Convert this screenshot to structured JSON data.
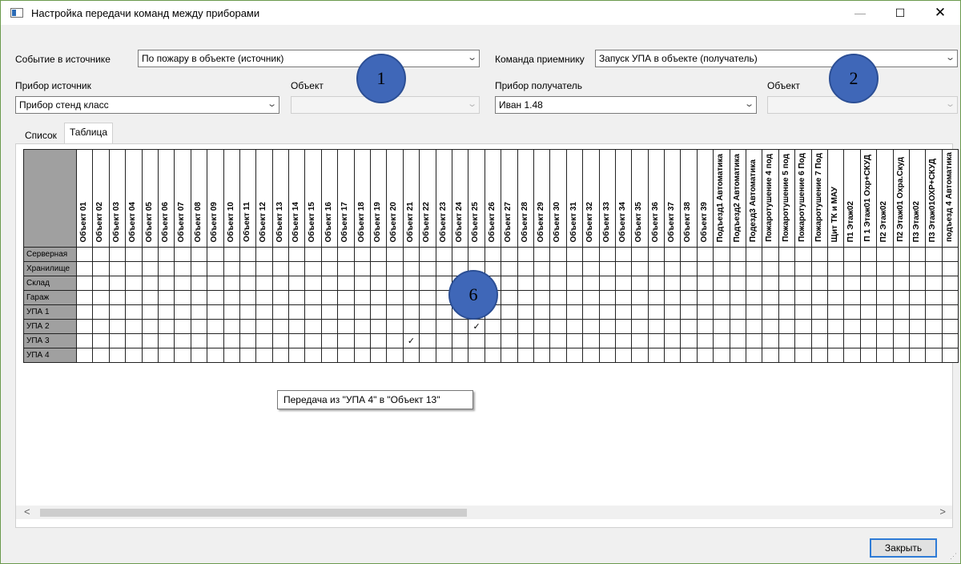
{
  "window": {
    "title": "Настройка передачи команд между приборами",
    "minimize": "—",
    "maximize": "☐",
    "close": "✕"
  },
  "source": {
    "event_label": "Событие в источнике",
    "event_value": "По пожару в объекте (источник)",
    "device_label": "Прибор источник",
    "device_value": "Прибор стенд класс",
    "object_label": "Объект",
    "object_value": ""
  },
  "target": {
    "command_label": "Команда приемнику",
    "command_value": "Запуск УПА в объекте (получатель)",
    "device_label": "Прибор получатель",
    "device_value": "Иван 1.48",
    "object_label": "Объект",
    "object_value": ""
  },
  "badges": {
    "b1": "1",
    "b2": "2",
    "b6": "6"
  },
  "tabs": {
    "list": "Список",
    "table": "Таблица"
  },
  "grid": {
    "columns": [
      "Объект 01",
      "Объект 02",
      "Объект 03",
      "Объект 04",
      "Объект 05",
      "Объект 06",
      "Объект 07",
      "Объект 08",
      "Объект 09",
      "Объект 10",
      "Объект 11",
      "Объект 12",
      "Объект 13",
      "Объект 14",
      "Объект 15",
      "Объект 16",
      "Объект 17",
      "Объект 18",
      "Объект 19",
      "Объект 20",
      "Объект 21",
      "Объект 22",
      "Объект 23",
      "Объект 24",
      "Объект 25",
      "Объект 26",
      "Объект 27",
      "Объект 28",
      "Объект 29",
      "Объект 30",
      "Объект 31",
      "Объект 32",
      "Объект 33",
      "Объект 34",
      "Объект 35",
      "Объект 36",
      "Объект 37",
      "Объект 38",
      "Объект 39",
      "Подъезд1 Автоматика",
      "Подъезд2 Автоматика",
      "Подезд3 Автоматика",
      "Пожаротушение 4 под",
      "Пожаротушение 5 под",
      "Пожаротушение 6 Под",
      "Пожаротушение 7 Под",
      "Щит ТК и МАУ",
      "П1 Этаж02",
      "П 1 Этаж01 Охр+СКУД",
      "П2 Этаж02",
      "П2 Этаж01 Охра.Скуд",
      "П3 Этаж02",
      "П3 Этаж01ОХР+СКУД",
      "подъезд 4 Автоматика"
    ],
    "rows": [
      "Серверная",
      "Хранилище",
      "Склад",
      "Гараж",
      "УПА 1",
      "УПА 2",
      "УПА 3",
      "УПА 4"
    ],
    "checks": [
      {
        "row": 5,
        "col": 24,
        "mark": "✓"
      },
      {
        "row": 6,
        "col": 20,
        "mark": "✓"
      }
    ]
  },
  "tooltip": "Передача из \"УПА 4\" в \"Объект 13\"",
  "scroll": {
    "left": "<",
    "right": ">"
  },
  "buttons": {
    "close": "Закрыть"
  }
}
